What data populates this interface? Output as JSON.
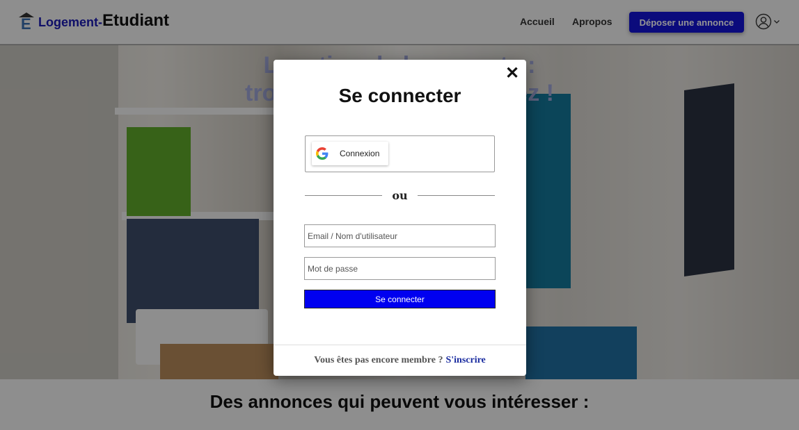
{
  "header": {
    "logo_part1": "Logement-",
    "logo_part2": "Etudiant",
    "nav": {
      "home": "Accueil",
      "about": "Apropos"
    },
    "post_button": "Déposer une annonce"
  },
  "hero": {
    "headline_line1": "Location de logements :",
    "headline_line2": "trouvez ce que vous louez !"
  },
  "section_title": "Des annonces qui peuvent vous intéresser :",
  "modal": {
    "title": "Se connecter",
    "close_symbol": "✕",
    "google_button": "Connexion",
    "separator": "ou",
    "email_placeholder": "Email / Nom d'utilisateur",
    "password_placeholder": "Mot de passe",
    "submit_label": "Se connecter",
    "footer_question": "Vous êtes pas encore membre ?",
    "footer_link": "S'inscrire"
  },
  "colors": {
    "brand_blue": "#1a1ab4",
    "primary_button": "#0000f0",
    "post_button": "#1414d6"
  }
}
